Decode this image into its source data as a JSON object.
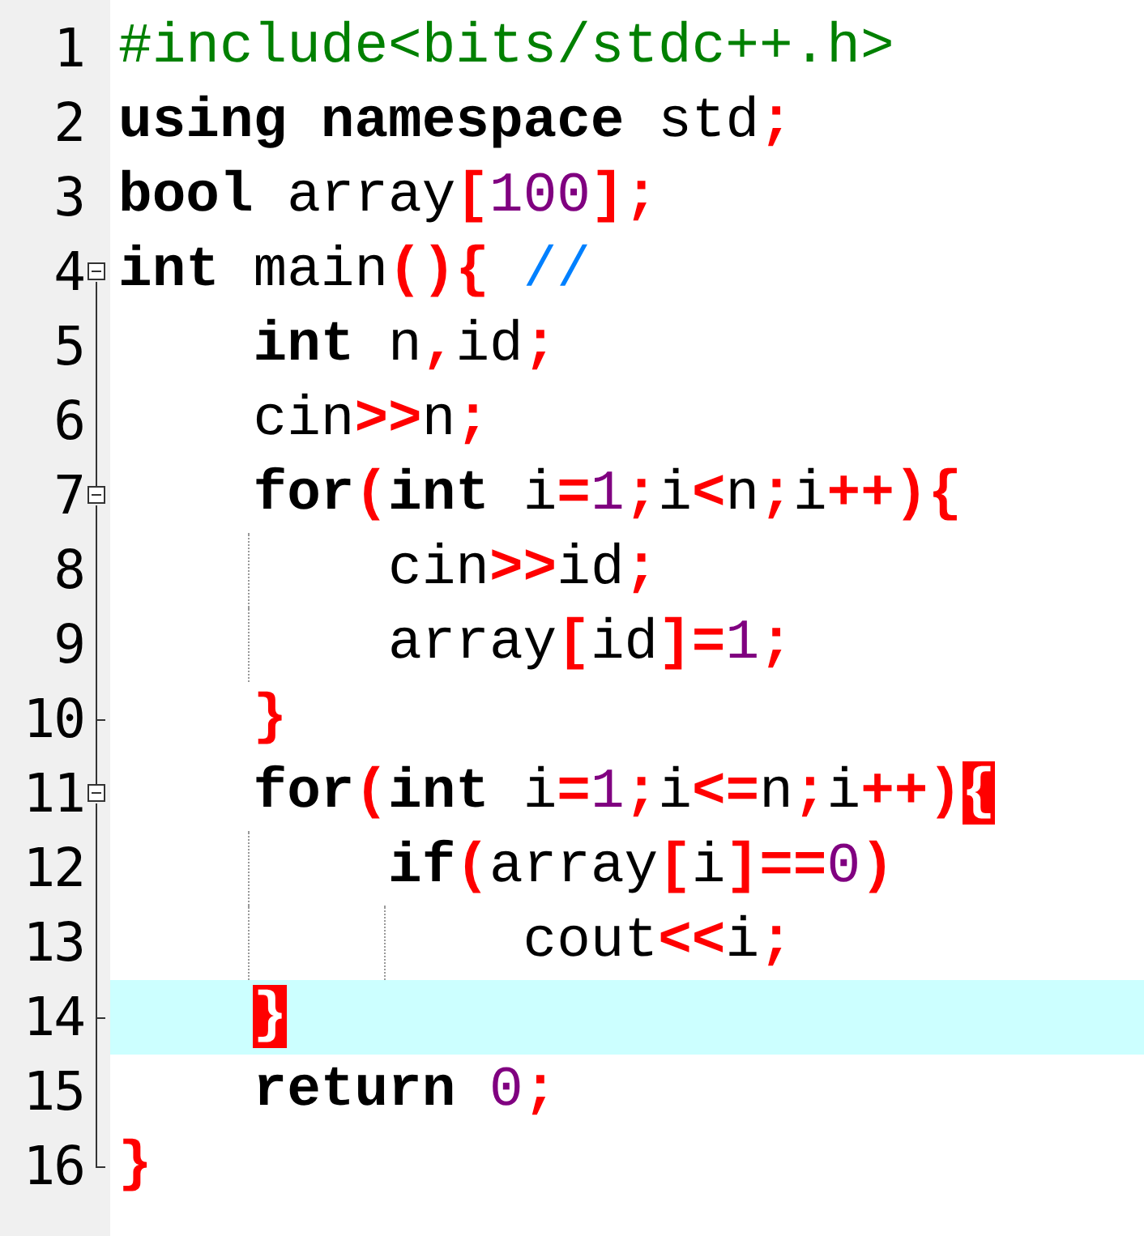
{
  "editor": {
    "lines": [
      {
        "number": "1",
        "current": false,
        "tokens": [
          {
            "kind": "pp",
            "text": "#include<bits/stdc++.h>"
          }
        ]
      },
      {
        "number": "2",
        "current": false,
        "tokens": [
          {
            "kind": "kw",
            "text": "using namespace"
          },
          {
            "kind": "id",
            "text": " std"
          },
          {
            "kind": "op",
            "text": ";"
          }
        ]
      },
      {
        "number": "3",
        "current": false,
        "tokens": [
          {
            "kind": "kw",
            "text": "bool"
          },
          {
            "kind": "id",
            "text": " array"
          },
          {
            "kind": "op",
            "text": "["
          },
          {
            "kind": "num",
            "text": "100"
          },
          {
            "kind": "op",
            "text": "];"
          }
        ]
      },
      {
        "number": "4",
        "current": false,
        "expanded": true,
        "tokens": [
          {
            "kind": "kw",
            "text": "int"
          },
          {
            "kind": "id",
            "text": " main"
          },
          {
            "kind": "op",
            "text": "(){"
          },
          {
            "kind": "cm",
            "text": " //"
          }
        ],
        "children": [
          {
            "number": "5",
            "current": false,
            "tokens": [
              {
                "kind": "kw",
                "text": "    int"
              },
              {
                "kind": "id",
                "text": " n"
              },
              {
                "kind": "op",
                "text": ","
              },
              {
                "kind": "id",
                "text": "id"
              },
              {
                "kind": "op",
                "text": ";"
              }
            ]
          },
          {
            "number": "6",
            "current": false,
            "tokens": [
              {
                "kind": "id",
                "text": "    cin"
              },
              {
                "kind": "op",
                "text": ">>"
              },
              {
                "kind": "id",
                "text": "n"
              },
              {
                "kind": "op",
                "text": ";"
              }
            ]
          },
          {
            "number": "7",
            "current": false,
            "expanded": true,
            "tokens": [
              {
                "kind": "kw",
                "text": "    for"
              },
              {
                "kind": "op",
                "text": "("
              },
              {
                "kind": "kw",
                "text": "int"
              },
              {
                "kind": "id",
                "text": " i"
              },
              {
                "kind": "op",
                "text": "="
              },
              {
                "kind": "num",
                "text": "1"
              },
              {
                "kind": "op",
                "text": ";"
              },
              {
                "kind": "id",
                "text": "i"
              },
              {
                "kind": "op",
                "text": "<"
              },
              {
                "kind": "id",
                "text": "n"
              },
              {
                "kind": "op",
                "text": ";"
              },
              {
                "kind": "id",
                "text": "i"
              },
              {
                "kind": "op",
                "text": "++){"
              }
            ],
            "children": [
              {
                "number": "8",
                "current": false,
                "tokens": [
                  {
                    "kind": "id",
                    "text": "        cin"
                  },
                  {
                    "kind": "op",
                    "text": ">>"
                  },
                  {
                    "kind": "id",
                    "text": "id"
                  },
                  {
                    "kind": "op",
                    "text": ";"
                  }
                ]
              },
              {
                "number": "9",
                "current": false,
                "tokens": [
                  {
                    "kind": "id",
                    "text": "        array"
                  },
                  {
                    "kind": "op",
                    "text": "["
                  },
                  {
                    "kind": "id",
                    "text": "id"
                  },
                  {
                    "kind": "op",
                    "text": "]="
                  },
                  {
                    "kind": "num",
                    "text": "1"
                  },
                  {
                    "kind": "op",
                    "text": ";"
                  }
                ]
              }
            ]
          },
          {
            "number": "10",
            "current": false,
            "tokens": [
              {
                "kind": "op",
                "text": "    }"
              }
            ]
          },
          {
            "number": "11",
            "current": false,
            "expanded": true,
            "tokens": [
              {
                "kind": "kw",
                "text": "    for"
              },
              {
                "kind": "op",
                "text": "("
              },
              {
                "kind": "kw",
                "text": "int"
              },
              {
                "kind": "id",
                "text": " i"
              },
              {
                "kind": "op",
                "text": "="
              },
              {
                "kind": "num",
                "text": "1"
              },
              {
                "kind": "op",
                "text": ";"
              },
              {
                "kind": "id",
                "text": "i"
              },
              {
                "kind": "op",
                "text": "<="
              },
              {
                "kind": "id",
                "text": "n"
              },
              {
                "kind": "op",
                "text": ";"
              },
              {
                "kind": "id",
                "text": "i"
              },
              {
                "kind": "op",
                "text": "++)"
              },
              {
                "kind": "match",
                "text": "{"
              }
            ],
            "children": [
              {
                "number": "12",
                "current": false,
                "tokens": [
                  {
                    "kind": "kw",
                    "text": "        if"
                  },
                  {
                    "kind": "op",
                    "text": "("
                  },
                  {
                    "kind": "id",
                    "text": "array"
                  },
                  {
                    "kind": "op",
                    "text": "["
                  },
                  {
                    "kind": "id",
                    "text": "i"
                  },
                  {
                    "kind": "op",
                    "text": "]=="
                  },
                  {
                    "kind": "num",
                    "text": "0"
                  },
                  {
                    "kind": "op",
                    "text": ")"
                  }
                ]
              },
              {
                "number": "13",
                "current": false,
                "tokens": [
                  {
                    "kind": "id",
                    "text": "            cout"
                  },
                  {
                    "kind": "op",
                    "text": "<<"
                  },
                  {
                    "kind": "id",
                    "text": "i"
                  },
                  {
                    "kind": "op",
                    "text": ";"
                  }
                ]
              }
            ]
          },
          {
            "number": "14",
            "current": true,
            "tokens": [
              {
                "kind": "match",
                "text": "    }"
              }
            ]
          },
          {
            "number": "15",
            "current": false,
            "tokens": [
              {
                "kind": "kw",
                "text": "    return"
              },
              {
                "kind": "num",
                "text": " 0"
              },
              {
                "kind": "op",
                "text": ";"
              }
            ]
          }
        ]
      },
      {
        "number": "16",
        "current": false,
        "tokens": [
          {
            "kind": "op",
            "text": "}"
          }
        ]
      }
    ]
  }
}
